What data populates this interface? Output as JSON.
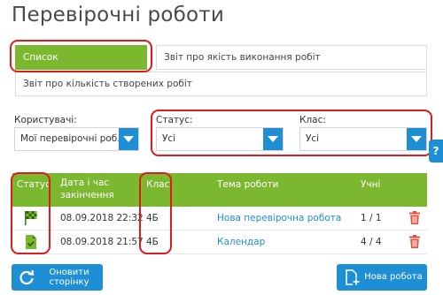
{
  "page": {
    "title": "Перевірочні роботи"
  },
  "tabs": [
    {
      "label": "Список",
      "active": true
    },
    {
      "label": "Звіт про якість виконання робіт",
      "active": false
    },
    {
      "label": "Звіт про кількість створених робіт",
      "active": false
    }
  ],
  "filters": {
    "users": {
      "label": "Користувачі:",
      "value": "Мої перевірочні роб..."
    },
    "status": {
      "label": "Статус:",
      "value": "Усі"
    },
    "class": {
      "label": "Клас:",
      "value": "Усі"
    }
  },
  "help": {
    "label": "?"
  },
  "table": {
    "headers": {
      "status": "Статус",
      "datetime_line1": "Дата і час",
      "datetime_line2": "закінчення",
      "class": "Клас",
      "topic": "Тема роботи",
      "students": "Учні"
    },
    "rows": [
      {
        "status_icon": "checkered-flag-icon",
        "datetime": "08.09.2018 22:32",
        "class": "4Б",
        "topic": "Нова перевірочна робота",
        "students": "1 / 1"
      },
      {
        "status_icon": "document-check-icon",
        "datetime": "08.09.2018 21:57",
        "class": "4Б",
        "topic": "Календар",
        "students": "4 / 4"
      }
    ]
  },
  "buttons": {
    "refresh_line1": "Оновити",
    "refresh_line2": "сторінку",
    "new_work": "Нова робота"
  },
  "colors": {
    "accent_green": "#7cb82f",
    "accent_blue": "#1e8fd5",
    "delete_red": "#e0553f",
    "highlight_red": "#e01b1b"
  }
}
